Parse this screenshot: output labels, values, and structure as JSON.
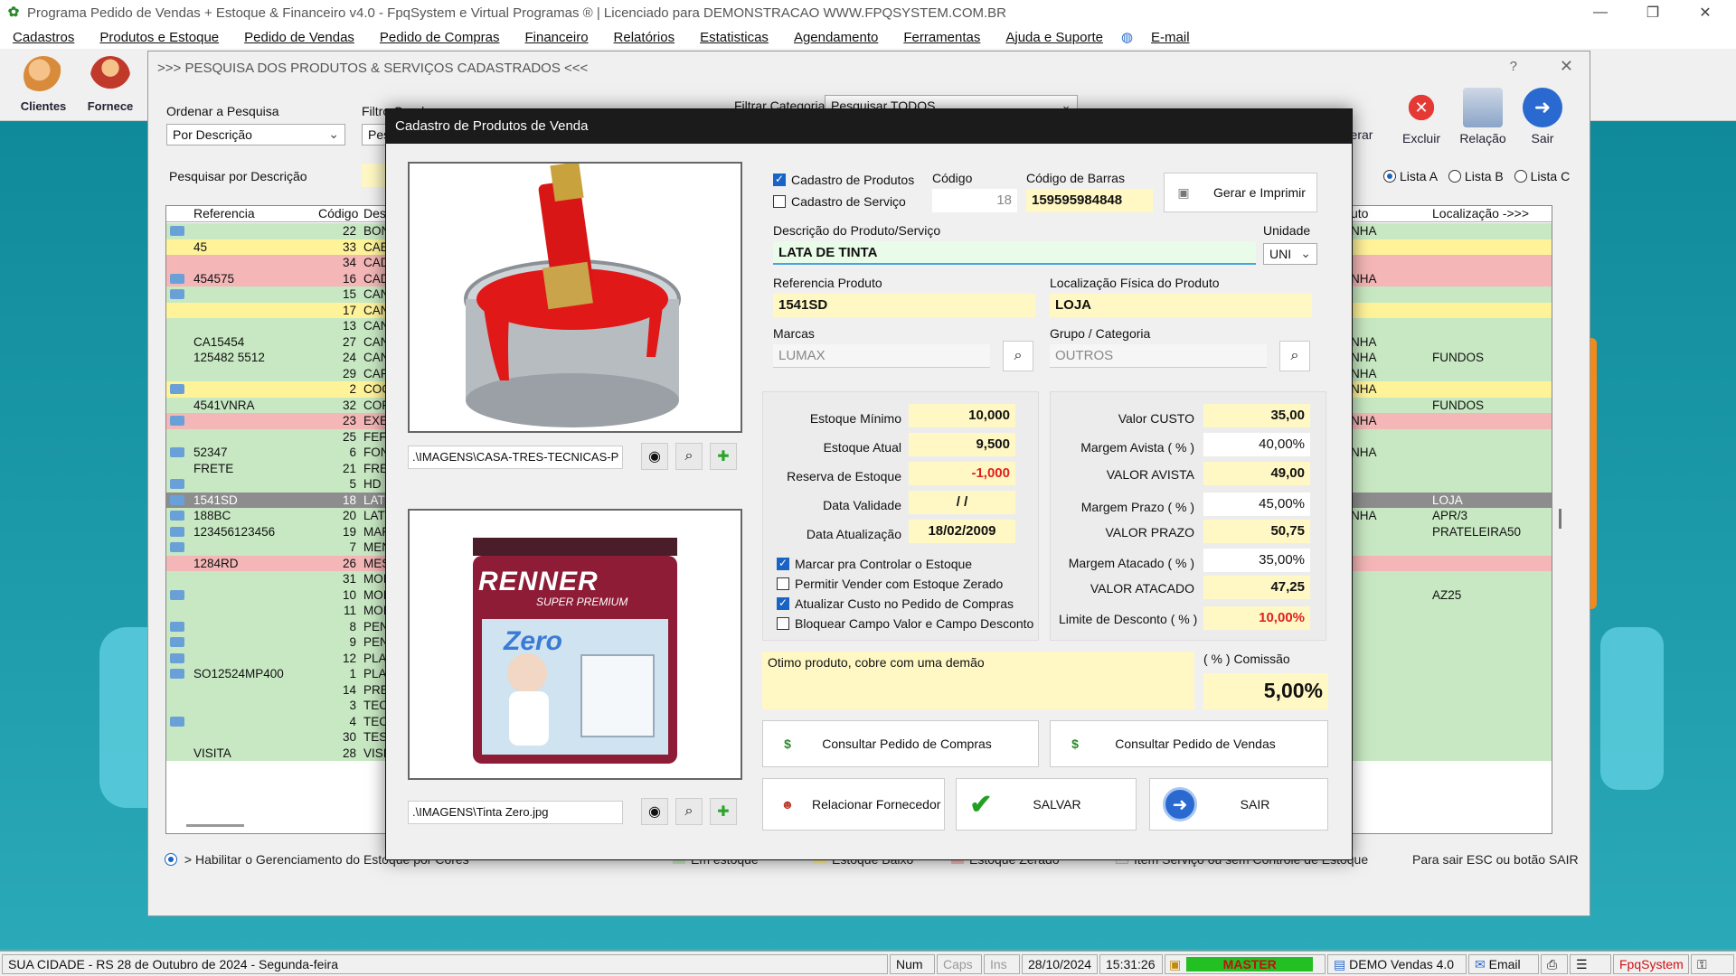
{
  "window": {
    "title": "Programa Pedido de Vendas + Estoque & Financeiro v4.0 - FpqSystem e Virtual Programas ® | Licenciado para  DEMONSTRACAO WWW.FPQSYSTEM.COM.BR"
  },
  "menu": [
    "Cadastros",
    "Produtos e Estoque",
    "Pedido de Vendas",
    "Pedido de Compras",
    "Financeiro",
    "Relatórios",
    "Estatisticas",
    "Agendamento",
    "Ferramentas",
    "Ajuda e Suporte",
    "E-mail"
  ],
  "toolbar": {
    "clientes": "Clientes",
    "fornece": "Fornece"
  },
  "search": {
    "title": ">>> PESQUISA DOS PRODUTOS & SERVIÇOS CADASTRADOS <<<",
    "order_label": "Ordenar a Pesquisa",
    "order_value": "Por Descrição",
    "filter_label": "Filtro Geral",
    "filter_value": "Pes",
    "cat_label": "Filtrar Categoria",
    "cat_value": "Pesquisar TODOS",
    "desc_label": "Pesquisar por Descrição",
    "btn_gerar": "erar",
    "btn_excluir": "Excluir",
    "btn_relacao": "Relação",
    "btn_sair": "Sair",
    "lista_a": "Lista A",
    "lista_b": "Lista B",
    "lista_c": "Lista C",
    "columns": {
      "ref": "Referencia",
      "cod": "Código",
      "desc": "Des",
      "uni": "uto",
      "loc": "Localização ->>>"
    },
    "rows": [
      {
        "ic": true,
        "ref": "",
        "cod": "22",
        "desc": "BON",
        "uni": "NHA",
        "loc": "",
        "c": "green"
      },
      {
        "ic": false,
        "ref": "45",
        "cod": "33",
        "desc": "CAE",
        "uni": "",
        "loc": "",
        "c": "yellow"
      },
      {
        "ic": false,
        "ref": "",
        "cod": "34",
        "desc": "CAD",
        "uni": "",
        "loc": "",
        "c": "pink"
      },
      {
        "ic": true,
        "ref": "454575",
        "cod": "16",
        "desc": "CAD",
        "uni": "NHA",
        "loc": "",
        "c": "pink"
      },
      {
        "ic": true,
        "ref": "",
        "cod": "15",
        "desc": "CAN",
        "uni": "",
        "loc": "",
        "c": "green"
      },
      {
        "ic": false,
        "ref": "",
        "cod": "17",
        "desc": "CAN",
        "uni": "",
        "loc": "",
        "c": "yellow"
      },
      {
        "ic": false,
        "ref": "",
        "cod": "13",
        "desc": "CAN",
        "uni": "",
        "loc": "",
        "c": "green"
      },
      {
        "ic": false,
        "ref": "CA15454",
        "cod": "27",
        "desc": "CAN",
        "uni": "NHA",
        "loc": "",
        "c": "green"
      },
      {
        "ic": false,
        "ref": "125482 5512",
        "cod": "24",
        "desc": "CAN",
        "uni": "NHA",
        "loc": "FUNDOS",
        "c": "green"
      },
      {
        "ic": false,
        "ref": "",
        "cod": "29",
        "desc": "CAF",
        "uni": "NHA",
        "loc": "",
        "c": "green"
      },
      {
        "ic": true,
        "ref": "",
        "cod": "2",
        "desc": "COC",
        "uni": "NHA",
        "loc": "",
        "c": "yellow"
      },
      {
        "ic": false,
        "ref": "4541VNRA",
        "cod": "32",
        "desc": "COF",
        "uni": "",
        "loc": "FUNDOS",
        "c": "green"
      },
      {
        "ic": true,
        "ref": "",
        "cod": "23",
        "desc": "EXE",
        "uni": "NHA",
        "loc": "",
        "c": "pink"
      },
      {
        "ic": false,
        "ref": "",
        "cod": "25",
        "desc": "FEF",
        "uni": "",
        "loc": "",
        "c": "green"
      },
      {
        "ic": true,
        "ref": "52347",
        "cod": "6",
        "desc": "FON",
        "uni": "NHA",
        "loc": "",
        "c": "green"
      },
      {
        "ic": false,
        "ref": "FRETE",
        "cod": "21",
        "desc": "FRE",
        "uni": "",
        "loc": "",
        "c": "green"
      },
      {
        "ic": true,
        "ref": "",
        "cod": "5",
        "desc": "HD",
        "uni": "",
        "loc": "",
        "c": "green"
      },
      {
        "ic": true,
        "ref": "1541SD",
        "cod": "18",
        "desc": "LAT",
        "uni": "",
        "loc": "LOJA",
        "c": "sel"
      },
      {
        "ic": true,
        "ref": "188BC",
        "cod": "20",
        "desc": "LAT",
        "uni": "NHA",
        "loc": "APR/3",
        "c": "green"
      },
      {
        "ic": true,
        "ref": "123456123456",
        "cod": "19",
        "desc": "MAF",
        "uni": "",
        "loc": "PRATELEIRA50",
        "c": "green"
      },
      {
        "ic": true,
        "ref": "",
        "cod": "7",
        "desc": "MEN",
        "uni": "",
        "loc": "",
        "c": "green"
      },
      {
        "ic": false,
        "ref": "1284RD",
        "cod": "26",
        "desc": "MES",
        "uni": "",
        "loc": "",
        "c": "pink"
      },
      {
        "ic": false,
        "ref": "",
        "cod": "31",
        "desc": "MOI",
        "uni": "",
        "loc": "",
        "c": "green"
      },
      {
        "ic": true,
        "ref": "",
        "cod": "10",
        "desc": "MOI",
        "uni": "",
        "loc": "AZ25",
        "c": "green"
      },
      {
        "ic": false,
        "ref": "",
        "cod": "11",
        "desc": "MOI",
        "uni": "",
        "loc": "",
        "c": "green"
      },
      {
        "ic": true,
        "ref": "",
        "cod": "8",
        "desc": "PEN",
        "uni": "",
        "loc": "",
        "c": "green"
      },
      {
        "ic": true,
        "ref": "",
        "cod": "9",
        "desc": "PEN",
        "uni": "",
        "loc": "",
        "c": "green"
      },
      {
        "ic": true,
        "ref": "",
        "cod": "12",
        "desc": "PLA",
        "uni": "",
        "loc": "",
        "c": "green"
      },
      {
        "ic": true,
        "ref": "SO12524MP400",
        "cod": "1",
        "desc": "PLA",
        "uni": "",
        "loc": "",
        "c": "green"
      },
      {
        "ic": false,
        "ref": "",
        "cod": "14",
        "desc": "PRE",
        "uni": "",
        "loc": "",
        "c": "green"
      },
      {
        "ic": false,
        "ref": "",
        "cod": "3",
        "desc": "TEC",
        "uni": "",
        "loc": "",
        "c": "green"
      },
      {
        "ic": true,
        "ref": "",
        "cod": "4",
        "desc": "TEC",
        "uni": "",
        "loc": "",
        "c": "green"
      },
      {
        "ic": false,
        "ref": "",
        "cod": "30",
        "desc": "TES",
        "uni": "",
        "loc": "",
        "c": "green"
      },
      {
        "ic": false,
        "ref": "VISITA",
        "cod": "28",
        "desc": "VISI",
        "uni": "",
        "loc": "",
        "c": "green"
      }
    ],
    "legend": {
      "habilitar": "> Habilitar o Gerenciamento do Estoque por Cores",
      "em_estoque": "Em estoque",
      "baixo": "Estoque Baixo",
      "zerado": "Estoque Zerado",
      "servico": "Item Serviço ou sem Controle de Estoque",
      "sair_hint": "Para sair ESC ou botão SAIR"
    }
  },
  "modal": {
    "title": "Cadastro de Produtos de Venda",
    "img1_path": ".\\IMAGENS\\CASA-TRES-TECNICAS-P",
    "img2_path": ".\\IMAGENS\\Tinta Zero.jpg",
    "can_brand": "RENNER",
    "can_sub": "SUPER PREMIUM",
    "can_product": "Zero",
    "chk_produtos": "Cadastro de Produtos",
    "chk_servico": "Cadastro de Serviço",
    "codigo_label": "Código",
    "codigo": "18",
    "barras_label": "Código de Barras",
    "barras": "159595984848",
    "gerar": "Gerar e Imprimir",
    "desc_label": "Descrição do Produto/Serviço",
    "desc": "LATA DE TINTA",
    "unidade_label": "Unidade",
    "unidade": "UNI",
    "ref_label": "Referencia Produto",
    "ref": "1541SD",
    "loc_label": "Localização Física do Produto",
    "loc": "LOJA",
    "marcas_label": "Marcas",
    "marcas": "LUMAX",
    "grupo_label": "Grupo / Categoria",
    "grupo": "OUTROS",
    "est_min_label": "Estoque Mínimo",
    "est_min": "10,000",
    "est_atual_label": "Estoque Atual",
    "est_atual": "9,500",
    "reserva_label": "Reserva de Estoque",
    "reserva": "-1,000",
    "validade_label": "Data Validade",
    "validade": " /  /",
    "atualiz_label": "Data Atualização",
    "atualiz": "18/02/2009",
    "chk_controlar": "Marcar pra Controlar o Estoque",
    "chk_zerado": "Permitir Vender com Estoque Zerado",
    "chk_custo": "Atualizar Custo no Pedido de Compras",
    "chk_bloquear": "Bloquear Campo Valor e Campo Desconto",
    "custo_label": "Valor CUSTO",
    "custo": "35,00",
    "m_avista_label": "Margem Avista ( % )",
    "m_avista": "40,00%",
    "v_avista_label": "VALOR AVISTA",
    "v_avista": "49,00",
    "m_prazo_label": "Margem Prazo ( % )",
    "m_prazo": "45,00%",
    "v_prazo_label": "VALOR PRAZO",
    "v_prazo": "50,75",
    "m_atac_label": "Margem Atacado ( % )",
    "m_atac": "35,00%",
    "v_atac_label": "VALOR ATACADO",
    "v_atac": "47,25",
    "desc_lim_label": "Limite de Desconto ( % )",
    "desc_lim": "10,00%",
    "obs": "Otimo produto, cobre com uma demão",
    "comissao_label": "( % ) Comissão",
    "comissao": "5,00%",
    "btn_consulta_compras": "Consultar Pedido de Compras",
    "btn_consulta_vendas": "Consultar Pedido de Vendas",
    "btn_fornecedor": "Relacionar Fornecedor",
    "btn_salvar": "SALVAR",
    "btn_sair": "SAIR"
  },
  "status": {
    "city": "SUA CIDADE - RS 28 de Outubro de 2024 - Segunda-feira",
    "num": "Num",
    "caps": "Caps",
    "ins": "Ins",
    "date": "28/10/2024",
    "time": "15:31:26",
    "master": "MASTER",
    "demo": "DEMO Vendas 4.0",
    "email": "Email",
    "brand": "FpqSystem"
  },
  "colors": {
    "green": "#c7e8c2",
    "yellow": "#fff39a",
    "pink": "#f4b6b6",
    "accent": "#1a63c6",
    "master": "#22c022"
  }
}
